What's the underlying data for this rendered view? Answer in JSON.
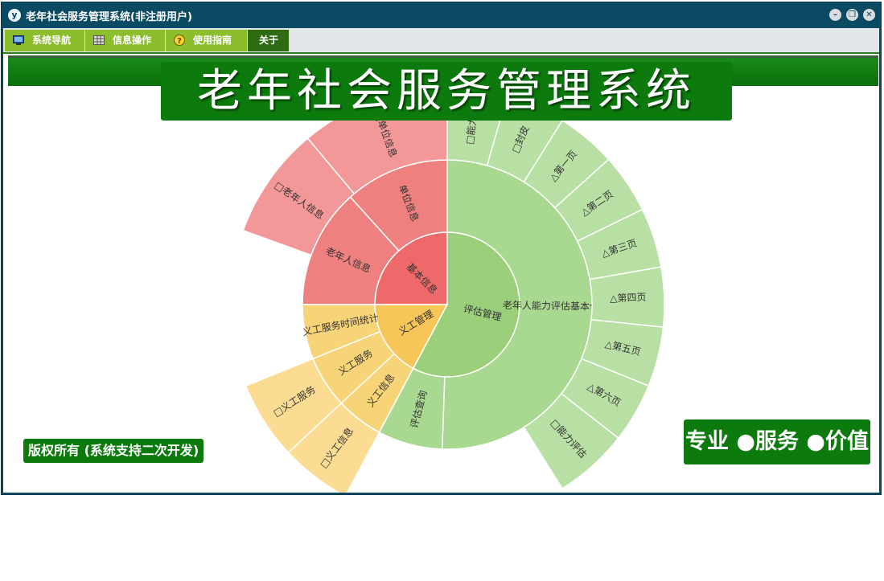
{
  "window": {
    "title": "老年社会服务管理系统(非注册用户)"
  },
  "menu": [
    {
      "label": "系统导航",
      "icon": "monitor-icon"
    },
    {
      "label": "信息操作",
      "icon": "grid-icon"
    },
    {
      "label": "使用指南",
      "icon": "help-icon"
    },
    {
      "label": "关于",
      "icon": ""
    }
  ],
  "banner": {
    "title": "老年社会服务管理系统"
  },
  "footer": {
    "copyright": "版权所有 (系统支持二次开发)",
    "slogan": "专业 ●服务 ●价值"
  },
  "colors": {
    "red": "#ee6f6f",
    "orange": "#f6c657",
    "green": "#a3d48a",
    "brand_green": "#0d7a0d"
  },
  "sunburst": {
    "inner": [
      {
        "label": "基本信息",
        "color": "#ee6a6a"
      },
      {
        "label": "义工管理",
        "color": "#f7c659"
      },
      {
        "label": "评估管理",
        "color": "#9bcf7a"
      }
    ],
    "middle": [
      {
        "label": "单位信息",
        "color": "#ee8080"
      },
      {
        "label": "老年人信息",
        "color": "#ee8080"
      },
      {
        "label": "义工服务时间统计",
        "color": "#f8d479"
      },
      {
        "label": "义工服务",
        "color": "#f8d479"
      },
      {
        "label": "义工信息",
        "color": "#f8d479"
      },
      {
        "label": "老年人能力评估基本信息",
        "color": "#a9d890"
      },
      {
        "label": "评估查询",
        "color": "#a9d890"
      }
    ],
    "outer": [
      {
        "label": "□单位信息",
        "color": "#f29898"
      },
      {
        "label": "□老年人信息",
        "color": "#f29898"
      },
      {
        "label": "□义工服务",
        "color": "#fbdc92"
      },
      {
        "label": "□义工信息",
        "color": "#fbdc92"
      },
      {
        "label": "□能力评",
        "color": "#b9e0a4"
      },
      {
        "label": "□封皮",
        "color": "#b9e0a4"
      },
      {
        "label": "△第一页",
        "color": "#b9e0a4"
      },
      {
        "label": "△第二页",
        "color": "#b9e0a4"
      },
      {
        "label": "△第三页",
        "color": "#b9e0a4"
      },
      {
        "label": "△第四页",
        "color": "#b9e0a4"
      },
      {
        "label": "△第五页",
        "color": "#b9e0a4"
      },
      {
        "label": "△第六页",
        "color": "#b9e0a4"
      },
      {
        "label": "□能力评估",
        "color": "#b9e0a4"
      }
    ]
  }
}
